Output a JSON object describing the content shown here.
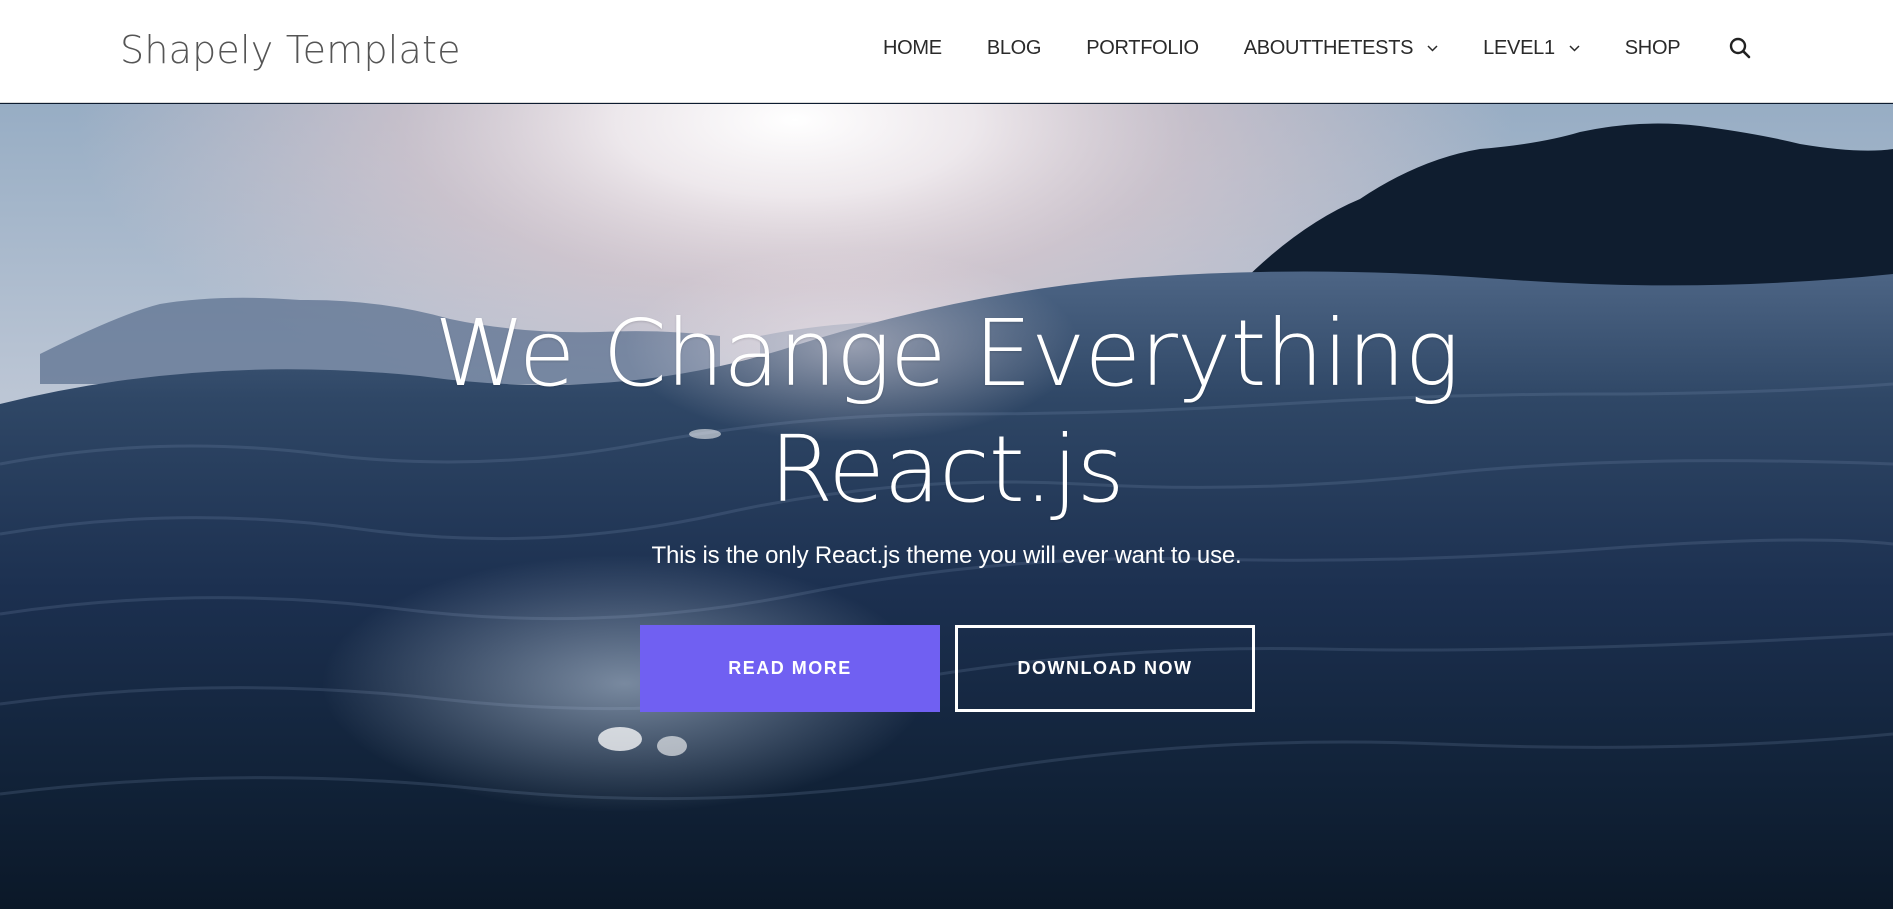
{
  "header": {
    "brand": "Shapely Template",
    "nav": [
      {
        "label": "HOME",
        "dropdown": false
      },
      {
        "label": "BLOG",
        "dropdown": false
      },
      {
        "label": "PORTFOLIO",
        "dropdown": false
      },
      {
        "label": "ABOUTTHETESTS",
        "dropdown": true
      },
      {
        "label": "LEVEL1",
        "dropdown": true
      },
      {
        "label": "SHOP",
        "dropdown": false
      }
    ],
    "search_icon": "search-icon",
    "dropdown_icon": "chevron-down-icon"
  },
  "hero": {
    "headline_line1": "We Change Everything",
    "headline_line2": "React.js",
    "subtitle": "This is the only React.js theme you will ever want to use.",
    "primary_button": "READ MORE",
    "secondary_button": "DOWNLOAD NOW"
  },
  "colors": {
    "accent": "#7060f2",
    "header_bg": "#ffffff",
    "nav_text": "#2a2a2a",
    "brand_text": "#555555",
    "hero_text": "#ffffff"
  }
}
